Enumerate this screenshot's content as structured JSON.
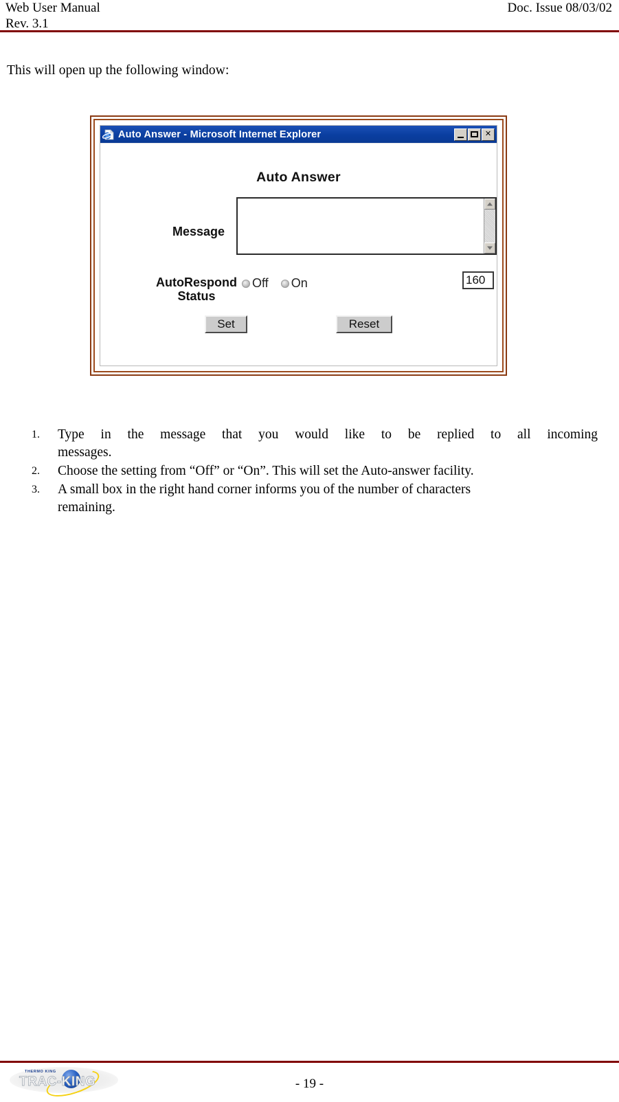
{
  "header": {
    "left_line1": "Web User Manual",
    "left_line2": "Rev. 3.1",
    "right": "Doc. Issue 08/03/02",
    "rule_color": "#800000"
  },
  "intro": {
    "text": "This will open up the following window:"
  },
  "dialog": {
    "titlebar": {
      "title": "Auto Answer - Microsoft Internet Explorer",
      "app_icon": "internet-explorer-icon",
      "minimize_label": "",
      "maximize_label": "",
      "close_label": "✕",
      "bg_color": "#0a3ea0"
    },
    "form": {
      "heading": "Auto Answer",
      "message_label": "Message",
      "message_value": "",
      "status_label_line1": "AutoRespond",
      "status_label_line2": "Status",
      "radios": [
        {
          "label": "Off",
          "selected": false
        },
        {
          "label": "On",
          "selected": false
        }
      ],
      "char_count_value": "160",
      "buttons": [
        {
          "label": "Set",
          "name": "set-button"
        },
        {
          "label": "Reset",
          "name": "reset-button"
        }
      ]
    }
  },
  "steps": [
    {
      "number": "1.",
      "line1": "Type in the message that you would like to be replied to all incoming",
      "line2": "messages."
    },
    {
      "number": "2.",
      "line1": "Choose the setting from “Off” or “On”.  This will set the Auto-answer facility.",
      "line2": ""
    },
    {
      "number": "3.",
      "line1": "A small box in the right hand corner informs you of the number of characters",
      "line2": "remaining."
    }
  ],
  "footer": {
    "logo_top_text": "THERMO KING",
    "logo_main_text": "TRAC-KING",
    "page_number": "- 19 -",
    "rule_color": "#800000"
  }
}
